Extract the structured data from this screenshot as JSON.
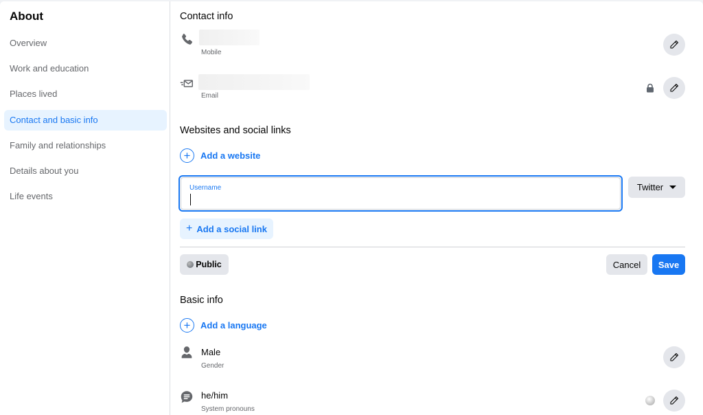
{
  "sidebar": {
    "title": "About",
    "items": [
      {
        "label": "Overview",
        "active": false
      },
      {
        "label": "Work and education",
        "active": false
      },
      {
        "label": "Places lived",
        "active": false
      },
      {
        "label": "Contact and basic info",
        "active": true
      },
      {
        "label": "Family and relationships",
        "active": false
      },
      {
        "label": "Details about you",
        "active": false
      },
      {
        "label": "Life events",
        "active": false
      }
    ]
  },
  "contact_info": {
    "title": "Contact info",
    "mobile": {
      "label": "Mobile",
      "icon": "phone-icon",
      "value_hidden": true
    },
    "email": {
      "label": "Email",
      "icon": "email-icon",
      "value_hidden": true,
      "audience_icon": "lock-icon"
    }
  },
  "websites": {
    "title": "Websites and social links",
    "add_website": "Add a website",
    "username_field": {
      "label": "Username",
      "value": ""
    },
    "network_select": {
      "selected": "Twitter"
    },
    "add_social_link": "Add a social link",
    "audience_button": "Public",
    "cancel_label": "Cancel",
    "save_label": "Save"
  },
  "basic_info": {
    "title": "Basic info",
    "add_language": "Add a language",
    "gender": {
      "value": "Male",
      "label": "Gender",
      "icon": "person-icon"
    },
    "pronouns": {
      "value": "he/him",
      "label": "System pronouns",
      "icon": "speech-bubble-icon",
      "audience_icon": "globe-icon"
    }
  },
  "colors": {
    "accent": "#1877f2",
    "accent_light": "#e7f3ff",
    "secondary_button": "#e4e6eb",
    "muted_text": "#65676b"
  }
}
